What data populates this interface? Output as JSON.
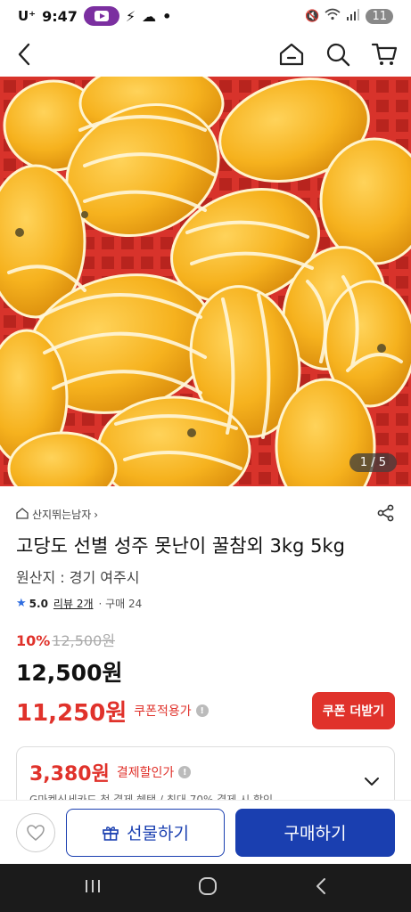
{
  "status_bar": {
    "carrier": "U⁺",
    "time": "9:47",
    "battery": "11"
  },
  "header": {
    "icons": [
      "back-icon",
      "home-icon",
      "search-icon",
      "cart-icon"
    ]
  },
  "gallery": {
    "counter": "1 / 5"
  },
  "product": {
    "seller": "산지뛰는남자",
    "title": "고당도 선별 성주 못난이 꿀참외 3kg 5kg",
    "origin": "원산지 : 경기 여주시",
    "rating": "5.0",
    "reviews": "리뷰 2개",
    "purchases": "· 구매 24",
    "discount_pct": "10%",
    "original_price": "12,500원",
    "price": "12,500원",
    "coupon_price": "11,250원",
    "coupon_label": "쿠폰적용가",
    "coupon_button": "쿠폰 더받기",
    "pay_price": "3,380원",
    "pay_label": "결제할인가",
    "pay_sub": "G마켓신세카드 첫 결제 혜택 / 최대 70% 결제 시 할인"
  },
  "actions": {
    "gift": "선물하기",
    "buy": "구매하기"
  },
  "colors": {
    "accent_red": "#e0322b",
    "brand_blue": "#1a3fb0"
  }
}
